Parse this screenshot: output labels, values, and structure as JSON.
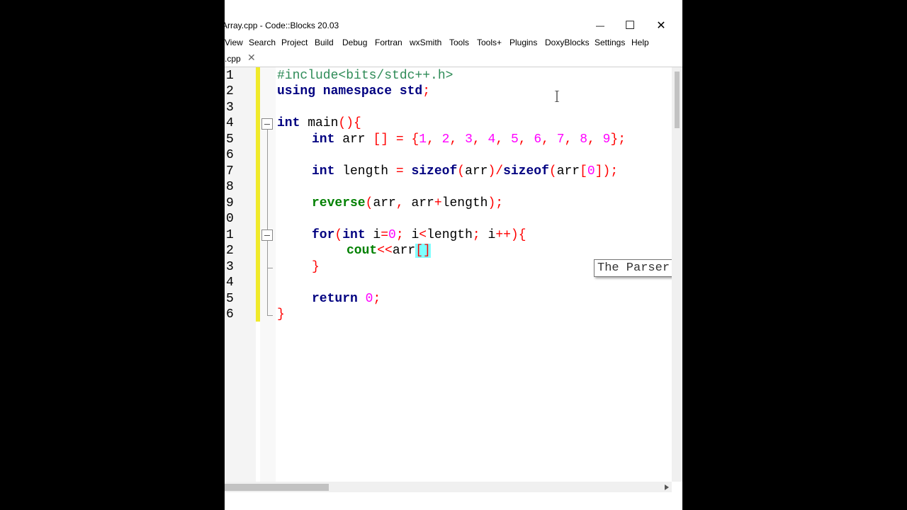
{
  "window": {
    "title": "Array.cpp - Code::Blocks 20.03"
  },
  "window_controls": {
    "minimize": "—",
    "maximize": "☐",
    "close": "✕"
  },
  "menu": [
    "View",
    "Search",
    "Project",
    "Build",
    "Debug",
    "Fortran",
    "wxSmith",
    "Tools",
    "Tools+",
    "Plugins",
    "DoxyBlocks",
    "Settings",
    "Help"
  ],
  "tab": {
    "label": ".cpp",
    "close": "✕"
  },
  "line_numbers": [
    "1",
    "2",
    "3",
    "4",
    "5",
    "6",
    "7",
    "8",
    "9",
    "0",
    "1",
    "2",
    "3",
    "4",
    "5",
    "6"
  ],
  "code": {
    "l1": "#include<bits/stdc++.h>",
    "l2_kw": "using namespace std",
    "l2_end": ";",
    "l4_kw": "int",
    "l4_id": " main",
    "l4_op": "(){",
    "l5_kw": "int",
    "l5_id": " arr",
    "l5_op1": "[] = {",
    "nums": [
      "1",
      "2",
      "3",
      "4",
      "5",
      "6",
      "7",
      "8",
      "9"
    ],
    "l5_end": "};",
    "l7_kw": "int",
    "l7_id": " length ",
    "l7_eq": "= ",
    "l7_fn1": "sizeof",
    "l7_p1": "(",
    "l7_arr1": "arr",
    "l7_p2": ")/",
    "l7_fn2": "sizeof",
    "l7_p3": "(",
    "l7_arr2": "arr",
    "l7_p4": "[",
    "l7_zero": "0",
    "l7_p5": "]);",
    "l9_fn": "reverse",
    "l9_p1": "(",
    "l9_a": "arr",
    "l9_c": ", ",
    "l9_b": "arr",
    "l9_plus": "+",
    "l9_len": "length",
    "l9_end": ");",
    "l11_kw": "for",
    "l11_p": "(",
    "l11_int": "int",
    "l11_i": " i",
    "l11_eq": "=",
    "l11_zero": "0",
    "l11_s1": "; ",
    "l11_i2": "i",
    "l11_lt": "<",
    "l11_len": "length",
    "l11_s2": "; ",
    "l11_i3": "i",
    "l11_pp": "++){",
    "l12_fn": "cout",
    "l12_op": "<<",
    "l12_arr": "arr",
    "l12_br": "[]",
    "l13": "}",
    "l15_kw": "return",
    "l15_zero": "0",
    "l15_end": ";",
    "l16": "}"
  },
  "tooltip": "The Parser is still parsing files.",
  "icons": {
    "cursor": "i-beam-cursor-icon"
  },
  "colors": {
    "keyword": "#000080",
    "function": "#008000",
    "number": "#ff00ff",
    "operator": "#ff0000",
    "preprocessor": "#2e8b57",
    "changebar": "#f0ea2a"
  }
}
